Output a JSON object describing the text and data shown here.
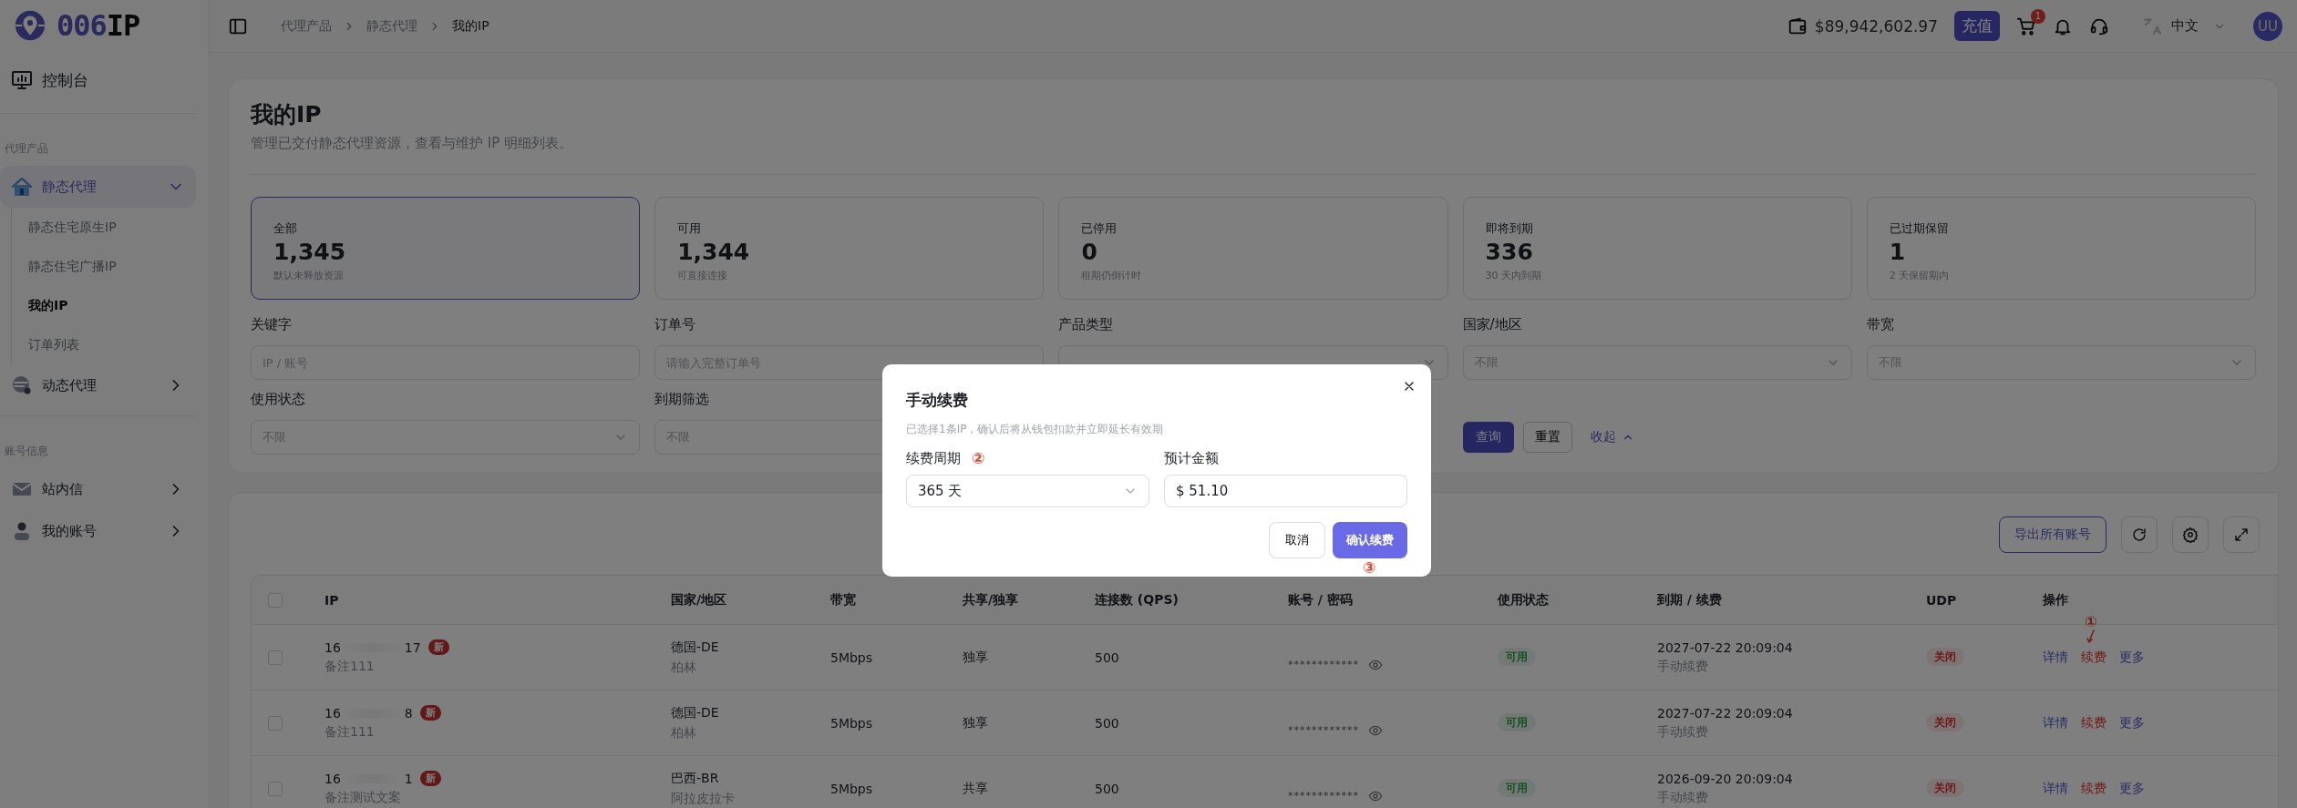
{
  "brand": {
    "logo_primary": "006",
    "logo_secondary": "IP"
  },
  "sidebar": {
    "top_item": {
      "label": "控制台"
    },
    "sections": [
      {
        "title": "代理产品",
        "items": [
          {
            "label": "静态代理",
            "kind": "house",
            "expanded": true,
            "children": [
              {
                "label": "静态住宅原生IP",
                "selected": false
              },
              {
                "label": "静态住宅广播IP",
                "selected": false
              },
              {
                "label": "我的IP",
                "selected": true
              },
              {
                "label": "订单列表",
                "selected": false
              }
            ]
          },
          {
            "label": "动态代理",
            "kind": "globe",
            "expanded": false
          }
        ]
      },
      {
        "title": "账号信息",
        "items": [
          {
            "label": "站内信",
            "kind": "mail",
            "expanded": false
          },
          {
            "label": "我的账号",
            "kind": "user",
            "expanded": false
          }
        ]
      }
    ]
  },
  "header": {
    "breadcrumb": [
      "代理产品",
      "静态代理",
      "我的IP"
    ],
    "balance": "$89,942,602.97",
    "recharge": "充值",
    "cart_count": "1",
    "language": "中文",
    "avatar": "UU"
  },
  "page": {
    "title": "我的IP",
    "subtitle": "管理已交付静态代理资源，查看与维护 IP 明细列表。"
  },
  "stats": [
    {
      "label": "全部",
      "value": "1,345",
      "note": "默认未释放资源",
      "selected": true
    },
    {
      "label": "可用",
      "value": "1,344",
      "note": "可直接连接",
      "selected": false
    },
    {
      "label": "已停用",
      "value": "0",
      "note": "租期仍倒计时",
      "selected": false
    },
    {
      "label": "即将到期",
      "value": "336",
      "note": "30 天内到期",
      "selected": false
    },
    {
      "label": "已过期保留",
      "value": "1",
      "note": "2 天保留期内",
      "selected": false
    }
  ],
  "filters": [
    {
      "kind": "input",
      "label": "关键字",
      "placeholder": "IP / 账号"
    },
    {
      "kind": "input",
      "label": "订单号",
      "placeholder": "请输入完整订单号"
    },
    {
      "kind": "select",
      "label": "产品类型"
    },
    {
      "kind": "select",
      "label": "国家/地区",
      "placeholder": "不限"
    },
    {
      "kind": "select",
      "label": "带宽",
      "placeholder": "不限"
    },
    {
      "kind": "select",
      "label": "使用状态",
      "placeholder": "不限"
    },
    {
      "kind": "select",
      "label": "到期筛选",
      "placeholder": "不限"
    }
  ],
  "filter_actions": {
    "search": "查询",
    "reset": "重置",
    "collapse": "收起"
  },
  "toolbar": {
    "export": "导出所有账号"
  },
  "table": {
    "all_selected": false,
    "columns": [
      "IP",
      "国家/地区",
      "带宽",
      "共享/独享",
      "连接数 (QPS)",
      "账号 / 密码",
      "使用状态",
      "到期 / 续费",
      "UDP",
      "操作"
    ],
    "rows": [
      {
        "selected": false,
        "ip_head": "16",
        "ip_tail": "17",
        "badge": "新",
        "note": "备注111",
        "country": "德国-DE",
        "city": "柏林",
        "bandwidth": "5Mbps",
        "share": "独享",
        "qps": "500",
        "password": "************",
        "status": "可用",
        "expiry": "2027-07-22 20:09:04",
        "renew_mode": "手动续费",
        "udp": "关闭",
        "actions": [
          "详情",
          "续费",
          "更多"
        ],
        "annotation": "①"
      },
      {
        "selected": false,
        "ip_head": "16",
        "ip_tail": "8",
        "badge": "新",
        "note": "备注111",
        "country": "德国-DE",
        "city": "柏林",
        "bandwidth": "5Mbps",
        "share": "独享",
        "qps": "500",
        "password": "************",
        "status": "可用",
        "expiry": "2027-07-22 20:09:04",
        "renew_mode": "手动续费",
        "udp": "关闭",
        "actions": [
          "详情",
          "续费",
          "更多"
        ]
      },
      {
        "selected": false,
        "ip_head": "16",
        "ip_tail": "1",
        "badge": "新",
        "note": "备注测试文案",
        "country": "巴西-BR",
        "city": "阿拉皮拉卡",
        "bandwidth": "5Mbps",
        "share": "共享",
        "qps": "500",
        "password": "************",
        "status": "可用",
        "expiry": "2026-09-20 20:09:04",
        "renew_mode": "手动续费",
        "udp": "关闭",
        "actions": [
          "详情",
          "续费",
          "更多"
        ]
      }
    ]
  },
  "modal": {
    "title": "手动续费",
    "description": "已选择1条IP，确认后将从钱包扣款并立即延长有效期",
    "period": {
      "label": "续费周期",
      "annotation": "②",
      "value": "365 天"
    },
    "amount": {
      "label": "预计金额",
      "value": "$ 51.10"
    },
    "cancel": "取消",
    "confirm": "确认续费",
    "confirm_annotation": "③"
  }
}
